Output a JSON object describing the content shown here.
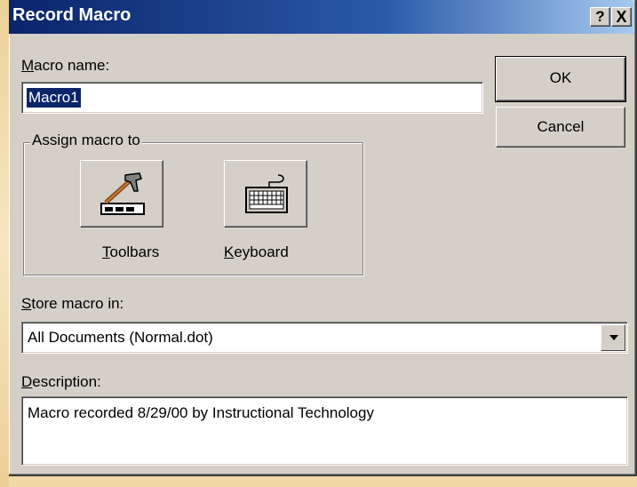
{
  "window": {
    "title": "Record Macro",
    "help_label": "?",
    "close_label": "X"
  },
  "macro_name": {
    "label_accel": "M",
    "label_rest": "acro name:",
    "value": "Macro1"
  },
  "buttons": {
    "ok": "OK",
    "cancel": "Cancel"
  },
  "assign": {
    "group_label": "Assign macro to",
    "toolbars": {
      "accel": "T",
      "rest": "oolbars",
      "icon": "toolbar-hammer-icon"
    },
    "keyboard": {
      "accel": "K",
      "rest": "eyboard",
      "icon": "keyboard-icon"
    }
  },
  "store": {
    "label_accel": "S",
    "label_rest": "tore macro in:",
    "value": "All Documents (Normal.dot)"
  },
  "description": {
    "label_accel": "D",
    "label_rest": "escription:",
    "value": "Macro recorded 8/29/00 by Instructional Technology"
  },
  "colors": {
    "titlebar": "#0a246a",
    "face": "#d4d0c8",
    "background": "#f1d9a6"
  }
}
